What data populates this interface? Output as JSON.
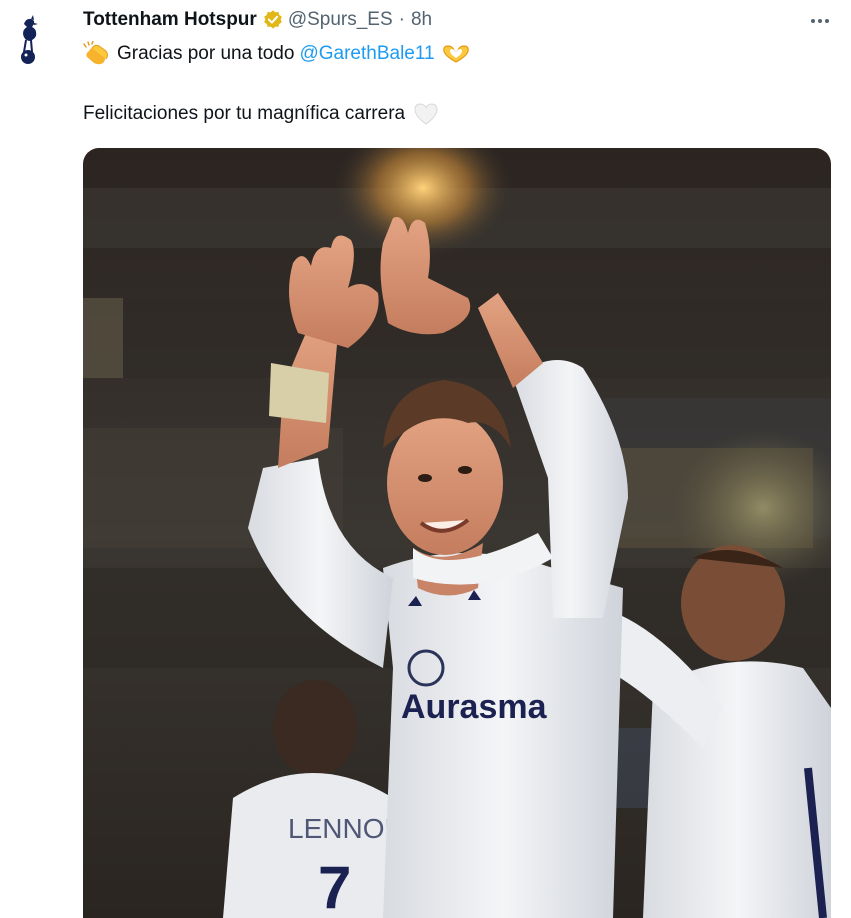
{
  "tweet": {
    "author_name": "Tottenham Hotspur",
    "handle": "@Spurs_ES",
    "separator": "·",
    "time": "8h",
    "text_line1": "Gracias por una todo",
    "mention": "@GarethBale11",
    "text_line2": "Felicitaciones por tu magnífica carrera"
  },
  "photo": {
    "sponsor": "Aurasma",
    "back_name": "LENNON",
    "back_number": "7"
  },
  "icons": {
    "avatar": "spurs-cockerel-crest",
    "verified": "gold-verified-badge",
    "more": "more-dots",
    "clap": "clapping-hands-emoji",
    "heart_hands": "heart-hands-emoji",
    "white_heart": "white-heart-emoji"
  },
  "colors": {
    "link": "#1d9bf0",
    "verified_gold": "#e2b719",
    "secondary_text": "#536471"
  }
}
